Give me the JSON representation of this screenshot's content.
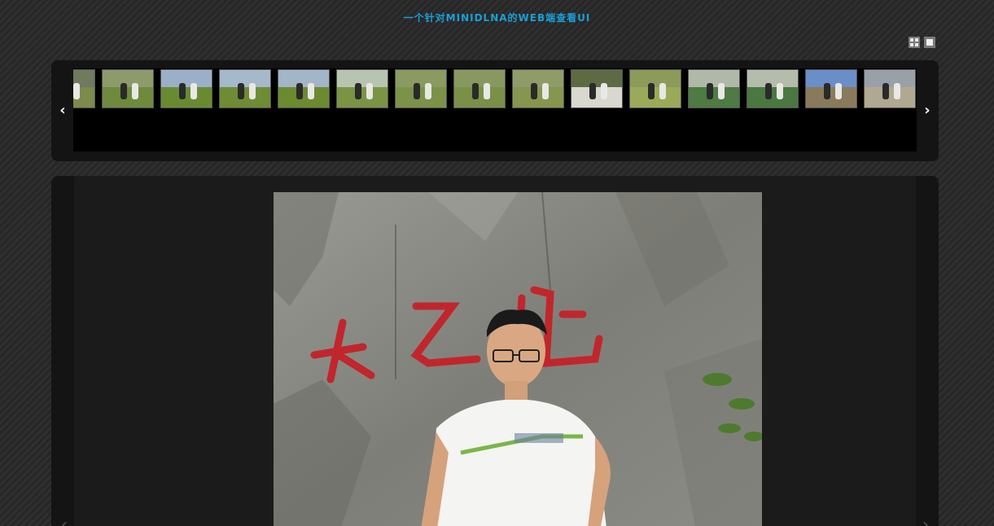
{
  "header": {
    "title": "一个针对MINIDLNA的WEB端查看UI"
  },
  "view_modes": [
    {
      "name": "grid-view",
      "icon": "grid-icon"
    },
    {
      "name": "single-view",
      "icon": "square-icon"
    }
  ],
  "filmstrip": {
    "prev_icon": "chevron-left-icon",
    "next_icon": "chevron-right-icon",
    "prev_glyph": "‹",
    "next_glyph": "›",
    "thumbnails": [
      {
        "scene": "person-dark-clothes-grass",
        "sky": "#6f7a5e",
        "ground": "#7c8a4c"
      },
      {
        "scene": "person-lying-grass",
        "sky": "#8d9a6c",
        "ground": "#6f8a3c"
      },
      {
        "scene": "group-building-grass",
        "sky": "#9bb0c8",
        "ground": "#6a8a32"
      },
      {
        "scene": "group-building-grass",
        "sky": "#a6b8cc",
        "ground": "#6e8c34"
      },
      {
        "scene": "group-building-grass",
        "sky": "#a2b5c9",
        "ground": "#6c8a30"
      },
      {
        "scene": "trees-lawn",
        "sky": "#b8c4b0",
        "ground": "#7a9444"
      },
      {
        "scene": "person-lying-lawn",
        "sky": "#8a9a60",
        "ground": "#7c9248"
      },
      {
        "scene": "person-lying-lawn",
        "sky": "#889860",
        "ground": "#7a9046"
      },
      {
        "scene": "two-people-sitting",
        "sky": "#8f9c68",
        "ground": "#86964e"
      },
      {
        "scene": "person-white-shirt",
        "sky": "#5e6a44",
        "ground": "#d8d8d0"
      },
      {
        "scene": "person-sitting-grass",
        "sky": "#8c9a5a",
        "ground": "#9aaa58"
      },
      {
        "scene": "two-people-green",
        "sky": "#b0b8a8",
        "ground": "#4e7a44"
      },
      {
        "scene": "two-people-green",
        "sky": "#b4bcac",
        "ground": "#4a7840"
      },
      {
        "scene": "person-blue-sky",
        "sky": "#6a8ec8",
        "ground": "#8a7a5c"
      },
      {
        "scene": "person-wall",
        "sky": "#9aa0a8",
        "ground": "#b0a890"
      }
    ]
  },
  "viewer": {
    "prev_glyph": "‹",
    "next_glyph": "›",
    "photo_subject": "person-in-front-of-rock-with-red-characters",
    "rock_inscription": "大乙觀"
  },
  "colors": {
    "accent": "#1a9fd6",
    "panel": "#141414",
    "strip_bg": "#000000"
  }
}
